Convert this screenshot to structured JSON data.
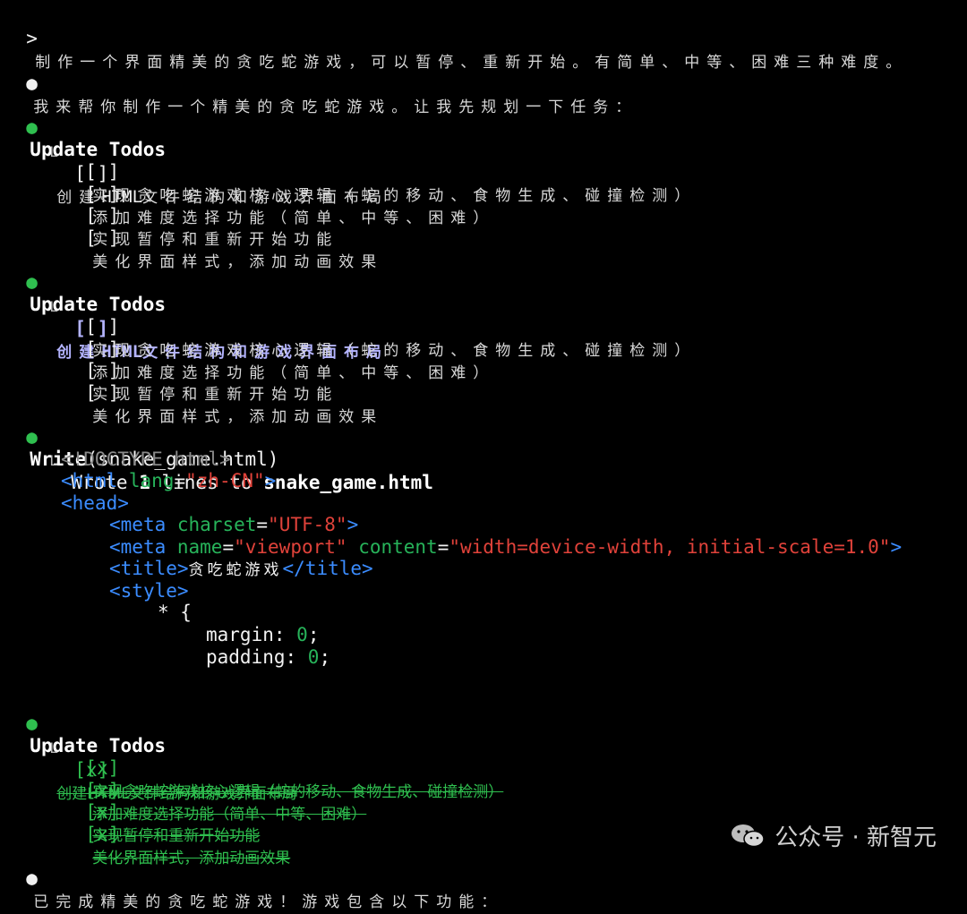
{
  "prompt": {
    "marker": ">",
    "text": "制作一个界面精美的贪吃蛇游戏，可以暂停、重新开始。有简单、中等、困难三种难度。"
  },
  "intro": {
    "bullet": "●",
    "text": "我来帮你制作一个精美的贪吃蛇游戏。让我先规划一下任务："
  },
  "todos_1": {
    "bullet": "●",
    "title": "Update Todos",
    "elbow": "L",
    "items": [
      {
        "box": "[ ]",
        "label_pre": "创建",
        "label_en": "HTML",
        "label_post": "文件结构和游戏界面布局"
      },
      {
        "box": "[ ]",
        "label": "实现贪吃蛇游戏核心逻辑（蛇的移动、食物生成、碰撞检测）"
      },
      {
        "box": "[ ]",
        "label": "添加难度选择功能（简单、中等、困难）"
      },
      {
        "box": "[ ]",
        "label": "实现暂停和重新开始功能"
      },
      {
        "box": "[ ]",
        "label": "美化界面样式，添加动画效果"
      }
    ]
  },
  "todos_2": {
    "bullet": "●",
    "title": "Update Todos",
    "elbow": "L",
    "items": [
      {
        "box": "[ ]",
        "label_pre": "创建",
        "label_en": "HTML",
        "label_post": "文件结构和游戏界面布局"
      },
      {
        "box": "[ ]",
        "label": "实现贪吃蛇游戏核心逻辑（蛇的移动、食物生成、碰撞检测）"
      },
      {
        "box": "[ ]",
        "label": "添加难度选择功能（简单、中等、困难）"
      },
      {
        "box": "[ ]",
        "label": "实现暂停和重新开始功能"
      },
      {
        "box": "[ ]",
        "label": "美化界面样式，添加动画效果"
      }
    ]
  },
  "write": {
    "bullet": "●",
    "cmd": "Write",
    "arg": "(snake_game.html)",
    "elbow": "L",
    "result_pre": "Wrote ",
    "result_count": "1",
    "result_mid": " lines to ",
    "result_file": "snake_game.html",
    "code": {
      "doctype": "<!DOCTYPE html>",
      "html_open": "<",
      "html_tag": "html",
      "html_attr": " lang",
      "html_eq": "=",
      "html_val": "\"zh-CN\"",
      "html_close": ">",
      "head_open": "<",
      "head_tag": "head",
      "head_close": ">",
      "meta1_open": "<",
      "meta1_tag": "meta",
      "meta1_attr": " charset",
      "meta1_eq": "=",
      "meta1_val": "\"UTF-8\"",
      "meta1_close": ">",
      "meta2_open": "<",
      "meta2_tag": "meta",
      "meta2_attr1": " name",
      "meta2_eq1": "=",
      "meta2_val1": "\"viewport\"",
      "meta2_attr2": " content",
      "meta2_eq2": "=",
      "meta2_val2": "\"width=device-width, initial-scale=1.0\"",
      "meta2_close": ">",
      "title_open": "<",
      "title_tag": "title",
      "title_mid": ">",
      "title_text": "贪吃蛇游戏",
      "title_end_open": "</",
      "title_end_tag": "title",
      "title_end_close": ">",
      "style_open": "<",
      "style_tag": "style",
      "style_close": ">",
      "selector": "* {",
      "prop1": "margin: ",
      "val1": "0",
      "semi1": ";",
      "prop2": "padding: ",
      "val2": "0",
      "semi2": ";"
    }
  },
  "todos_3": {
    "bullet": "●",
    "title": "Update Todos",
    "elbow": "L",
    "items": [
      {
        "box": "[x]",
        "label": "创建HTML文件结构和游戏界面布局"
      },
      {
        "box": "[x]",
        "label": "实现贪吃蛇游戏核心逻辑（蛇的移动、食物生成、碰撞检测）"
      },
      {
        "box": "[x]",
        "label": "添加难度选择功能（简单、中等、困难）"
      },
      {
        "box": "[x]",
        "label": "实现暂停和重新开始功能"
      },
      {
        "box": "[x]",
        "label": "美化界面样式，添加动画效果"
      }
    ]
  },
  "final": {
    "bullet": "●",
    "text": "已完成精美的贪吃蛇游戏！游戏包含以下功能："
  },
  "watermark": {
    "text": "公众号 · 新智元",
    "icon": "wechat-icon"
  }
}
